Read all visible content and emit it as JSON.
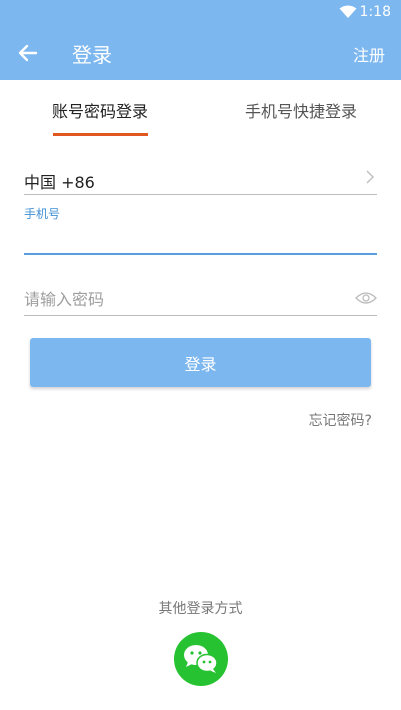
{
  "status_bar": {
    "time": "1:18"
  },
  "app_bar": {
    "title": "登录",
    "register_label": "注册"
  },
  "tabs": [
    {
      "label": "账号密码登录",
      "active": true
    },
    {
      "label": "手机号快捷登录",
      "active": false
    }
  ],
  "form": {
    "country_code": "中国 +86",
    "phone_label": "手机号",
    "phone_value": "",
    "password_placeholder": "请输入密码",
    "login_button": "登录",
    "forgot_password": "忘记密码?"
  },
  "other_login": {
    "label": "其他登录方式",
    "provider_icon": "wechat-icon"
  },
  "colors": {
    "primary": "#7db7ef",
    "tab_indicator": "#e0571f",
    "wechat": "#26c232"
  }
}
